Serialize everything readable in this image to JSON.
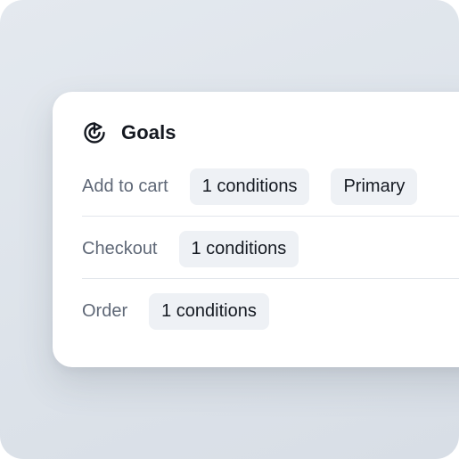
{
  "goals": {
    "icon": "target-goal-icon",
    "title": "Goals",
    "rows": [
      {
        "label": "Add to cart",
        "conditions": "1 conditions",
        "badge": "Primary"
      },
      {
        "label": "Checkout",
        "conditions": "1 conditions"
      },
      {
        "label": "Order",
        "conditions": "1 conditions"
      }
    ]
  },
  "colors": {
    "background": "#e1e6ec",
    "card": "#ffffff",
    "pill": "#eef1f5",
    "label_text": "#5f6877",
    "title_text": "#141820"
  }
}
